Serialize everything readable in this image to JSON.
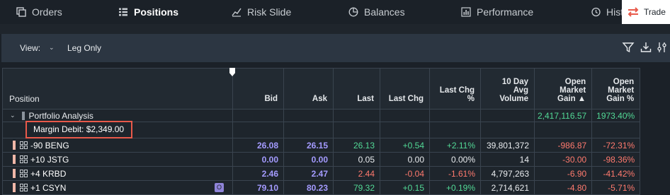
{
  "nav": {
    "tabs": [
      {
        "label": "Orders",
        "icon": "orders-icon"
      },
      {
        "label": "Positions",
        "icon": "positions-list-icon"
      },
      {
        "label": "Risk Slide",
        "icon": "risk-slide-icon"
      },
      {
        "label": "Balances",
        "icon": "balances-icon"
      },
      {
        "label": "Performance",
        "icon": "performance-chart-icon"
      },
      {
        "label": "Hist",
        "icon": "history-icon"
      }
    ],
    "active": "Positions",
    "trade_label": "Trade"
  },
  "toolbar": {
    "view_label": "View:",
    "view_value": "Leg Only"
  },
  "grid": {
    "headers": {
      "position": "Position",
      "bid": "Bid",
      "ask": "Ask",
      "last": "Last",
      "last_chg": "Last Chg",
      "last_chg_pct": [
        "Last Chg",
        "%"
      ],
      "avg_volume": [
        "10 Day",
        "Avg",
        "Volume"
      ],
      "open_gain": [
        "Open",
        "Market",
        "Gain ▲"
      ],
      "open_gain_pct": [
        "Open",
        "Market",
        "Gain %"
      ]
    },
    "group": {
      "label": "Portfolio Analysis",
      "open_gain": "2,417,116.57",
      "open_gain_pct": "1973.40%"
    },
    "margin_debit": "Margin Debit: $2,349.00",
    "rows": [
      {
        "symbol": "-90 BENG",
        "bid": "26.08",
        "ask": "26.15",
        "last": "26.13",
        "last_chg": "+0.54",
        "last_chg_pct": "+2.11%",
        "avg_volume": "39,801,372",
        "open_gain": "-986.87",
        "open_gain_pct": "-72.31%"
      },
      {
        "symbol": "+10 JSTG",
        "bid": "0.00",
        "ask": "0.00",
        "last": "0.05",
        "last_chg": "0.00",
        "last_chg_pct": "0.00%",
        "avg_volume": "14",
        "open_gain": "-30.00",
        "open_gain_pct": "-98.36%"
      },
      {
        "symbol": "+4 KRBD",
        "bid": "2.46",
        "ask": "2.47",
        "last": "2.44",
        "last_chg": "-0.04",
        "last_chg_pct": "-1.61%",
        "avg_volume": "4,797,263",
        "open_gain": "-6.90",
        "open_gain_pct": "-41.42%"
      },
      {
        "symbol": "+1 CSYN",
        "badge": "O",
        "bid": "79.10",
        "ask": "80.23",
        "last": "79.32",
        "last_chg": "+0.15",
        "last_chg_pct": "+0.19%",
        "avg_volume": "2,714,621",
        "open_gain": "-4.80",
        "open_gain_pct": "-5.71%"
      }
    ]
  }
}
